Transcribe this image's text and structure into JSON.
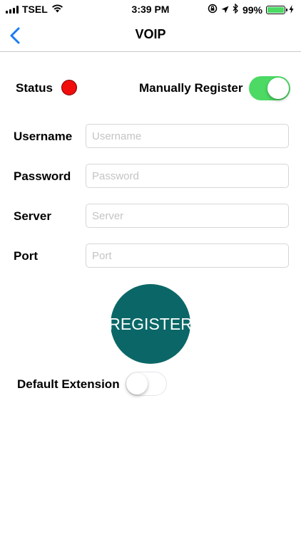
{
  "status_bar": {
    "carrier": "TSEL",
    "time": "3:39 PM",
    "battery": "99%",
    "battery_level": 0.99,
    "icons": [
      "signal-icon",
      "wifi-icon",
      "screen-lock-icon",
      "location-icon",
      "bluetooth-icon",
      "battery-icon",
      "charging-icon"
    ]
  },
  "nav": {
    "title": "VOIP",
    "back_icon": "chevron-left-icon",
    "accent_color": "#1a7bf2"
  },
  "status": {
    "label": "Status",
    "indicator_color": "#f20d0d"
  },
  "manual_register": {
    "label": "Manually Register",
    "on": true,
    "on_color": "#4cd964"
  },
  "form": {
    "username": {
      "label": "Username",
      "value": "",
      "placeholder": "Username"
    },
    "password": {
      "label": "Password",
      "value": "",
      "placeholder": "Password"
    },
    "server": {
      "label": "Server",
      "value": "",
      "placeholder": "Server"
    },
    "port": {
      "label": "Port",
      "value": "",
      "placeholder": "Port"
    }
  },
  "register_button": {
    "label": "REGISTER",
    "color": "#0b6767"
  },
  "default_extension": {
    "label": "Default Extension",
    "on": false
  }
}
